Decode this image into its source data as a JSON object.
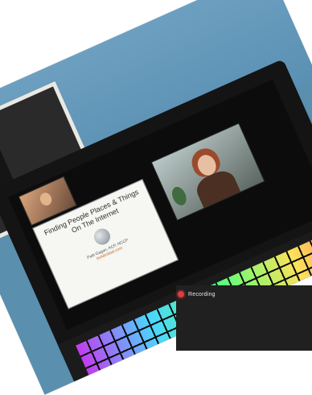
{
  "screen": {
    "slide": {
      "title": "Finding People Places & Things On The Internet",
      "name": "Patti Gagan, ACP, NCCP",
      "link": "ItsAllinMail.com"
    }
  },
  "overlay": {
    "recording_label": "Recording",
    "accent": "#e23c3c"
  }
}
